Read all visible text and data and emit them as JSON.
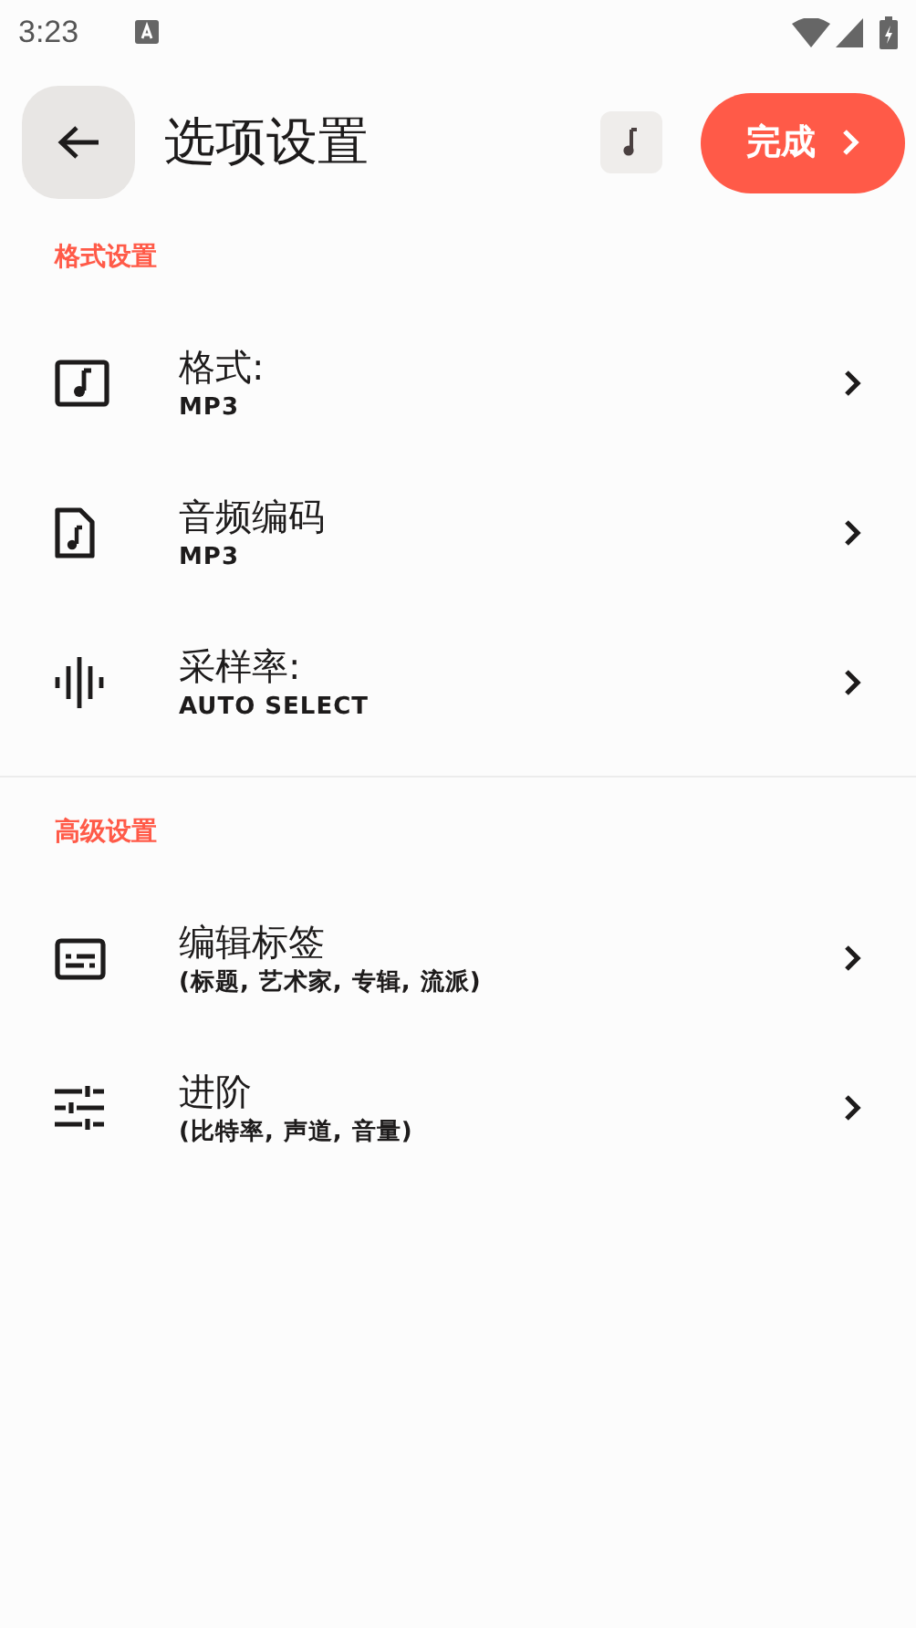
{
  "status_bar": {
    "time": "3:23"
  },
  "header": {
    "title": "选项设置",
    "done_button": "完成"
  },
  "sections": [
    {
      "title": "格式设置",
      "items": [
        {
          "title": "格式:",
          "subtitle": "MP3"
        },
        {
          "title": "音频编码",
          "subtitle": "MP3"
        },
        {
          "title": "采样率:",
          "subtitle": "AUTO SELECT"
        }
      ]
    },
    {
      "title": "高级设置",
      "items": [
        {
          "title": "编辑标签",
          "subtitle": "(标题, 艺术家, 专辑, 流派)"
        },
        {
          "title": "进阶",
          "subtitle": "(比特率, 声道, 音量)"
        }
      ]
    }
  ]
}
